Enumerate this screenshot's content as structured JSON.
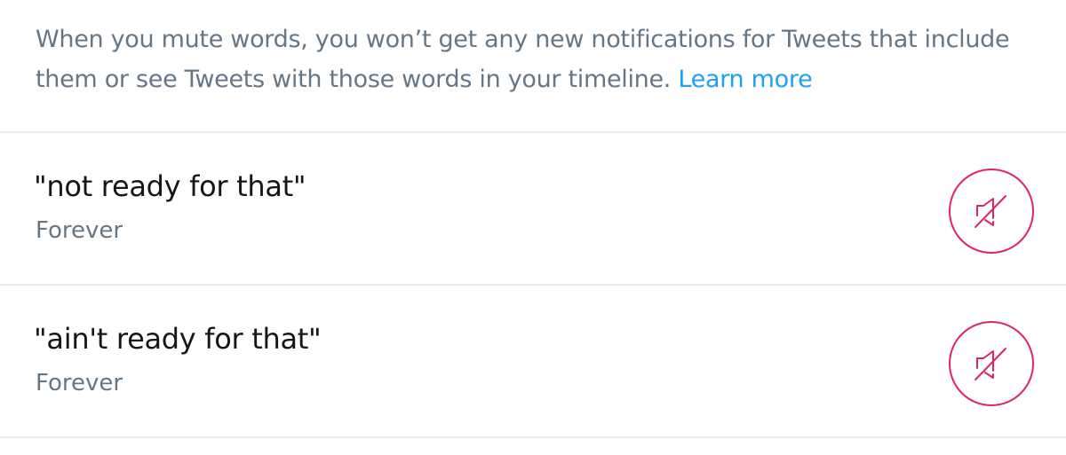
{
  "intro": {
    "text": "When you mute words, you won’t get any new notifications for Tweets that include them or see Tweets with those words in your timeline.",
    "link_label": "Learn more"
  },
  "muted_words": [
    {
      "phrase": "\"not ready for that\"",
      "duration": "Forever",
      "action_icon": "speaker-muted-icon"
    },
    {
      "phrase": "\"ain't ready for that\"",
      "duration": "Forever",
      "action_icon": "speaker-muted-icon"
    }
  ],
  "colors": {
    "accent_link": "#1da1f2",
    "unmute_red": "#e0245e",
    "secondary_text": "#657786",
    "primary_text": "#14171a",
    "divider": "#e6ecf0"
  }
}
